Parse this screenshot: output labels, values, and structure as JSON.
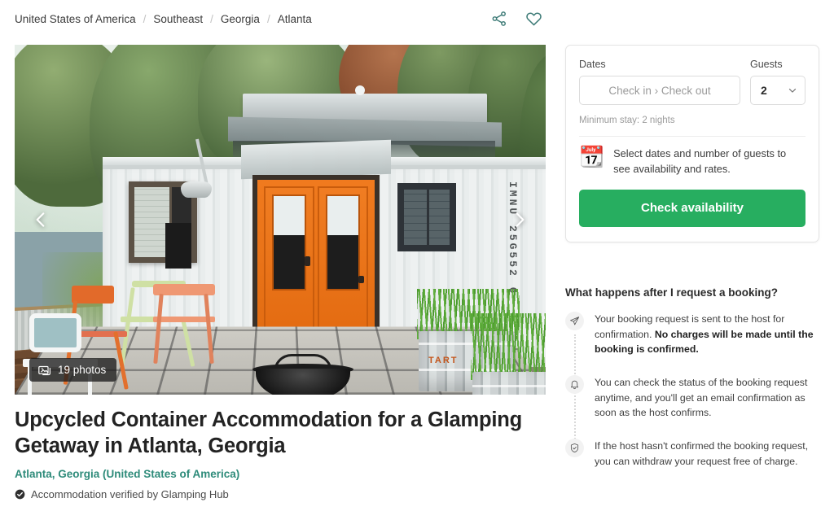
{
  "breadcrumb": {
    "items": [
      {
        "label": "United States of America"
      },
      {
        "label": "Southeast"
      },
      {
        "label": "Georgia"
      },
      {
        "label": "Atlanta"
      }
    ],
    "separator": "/"
  },
  "top_actions": {
    "share_icon": "share-icon",
    "favorite_icon": "heart-icon"
  },
  "gallery": {
    "photos_count_label": "19 photos",
    "photos_icon": "photo-stack-icon",
    "prev_icon": "chevron-left-icon",
    "next_icon": "chevron-right-icon",
    "container_code": "IMNU 25G552 6",
    "planter_text": "TART"
  },
  "listing": {
    "title": "Upcycled Container Accommodation for a Glamping Getaway in Atlanta, Georgia",
    "location": "Atlanta, Georgia (United States of America)",
    "verified_text": "Accommodation verified by Glamping Hub",
    "verified_icon": "check-badge-icon",
    "location_color": "#2e8b7a"
  },
  "booking": {
    "dates_label": "Dates",
    "dates_placeholder": "Check in › Check out",
    "guests_label": "Guests",
    "guests_value": "2",
    "guests_chevron_icon": "chevron-down-icon",
    "minimum_stay": "Minimum stay: 2 nights",
    "note_icon": "calendar-icon",
    "note_text": "Select dates and number of guests to see availability and rates.",
    "cta_label": "Check availability",
    "cta_color": "#27ae60"
  },
  "faq": {
    "heading": "What happens after I request a booking?",
    "steps": [
      {
        "icon": "paper-plane-icon",
        "text_plain": "Your booking request is sent to the host for confirmation. ",
        "text_bold": "No charges will be made until the booking is confirmed."
      },
      {
        "icon": "bell-icon",
        "text_plain": "You can check the status of the booking request anytime, and you'll get an email confirmation as soon as the host confirms.",
        "text_bold": ""
      },
      {
        "icon": "shield-check-icon",
        "text_plain": "If the host hasn't confirmed the booking request, you can withdraw your request free of charge.",
        "text_bold": ""
      }
    ]
  }
}
